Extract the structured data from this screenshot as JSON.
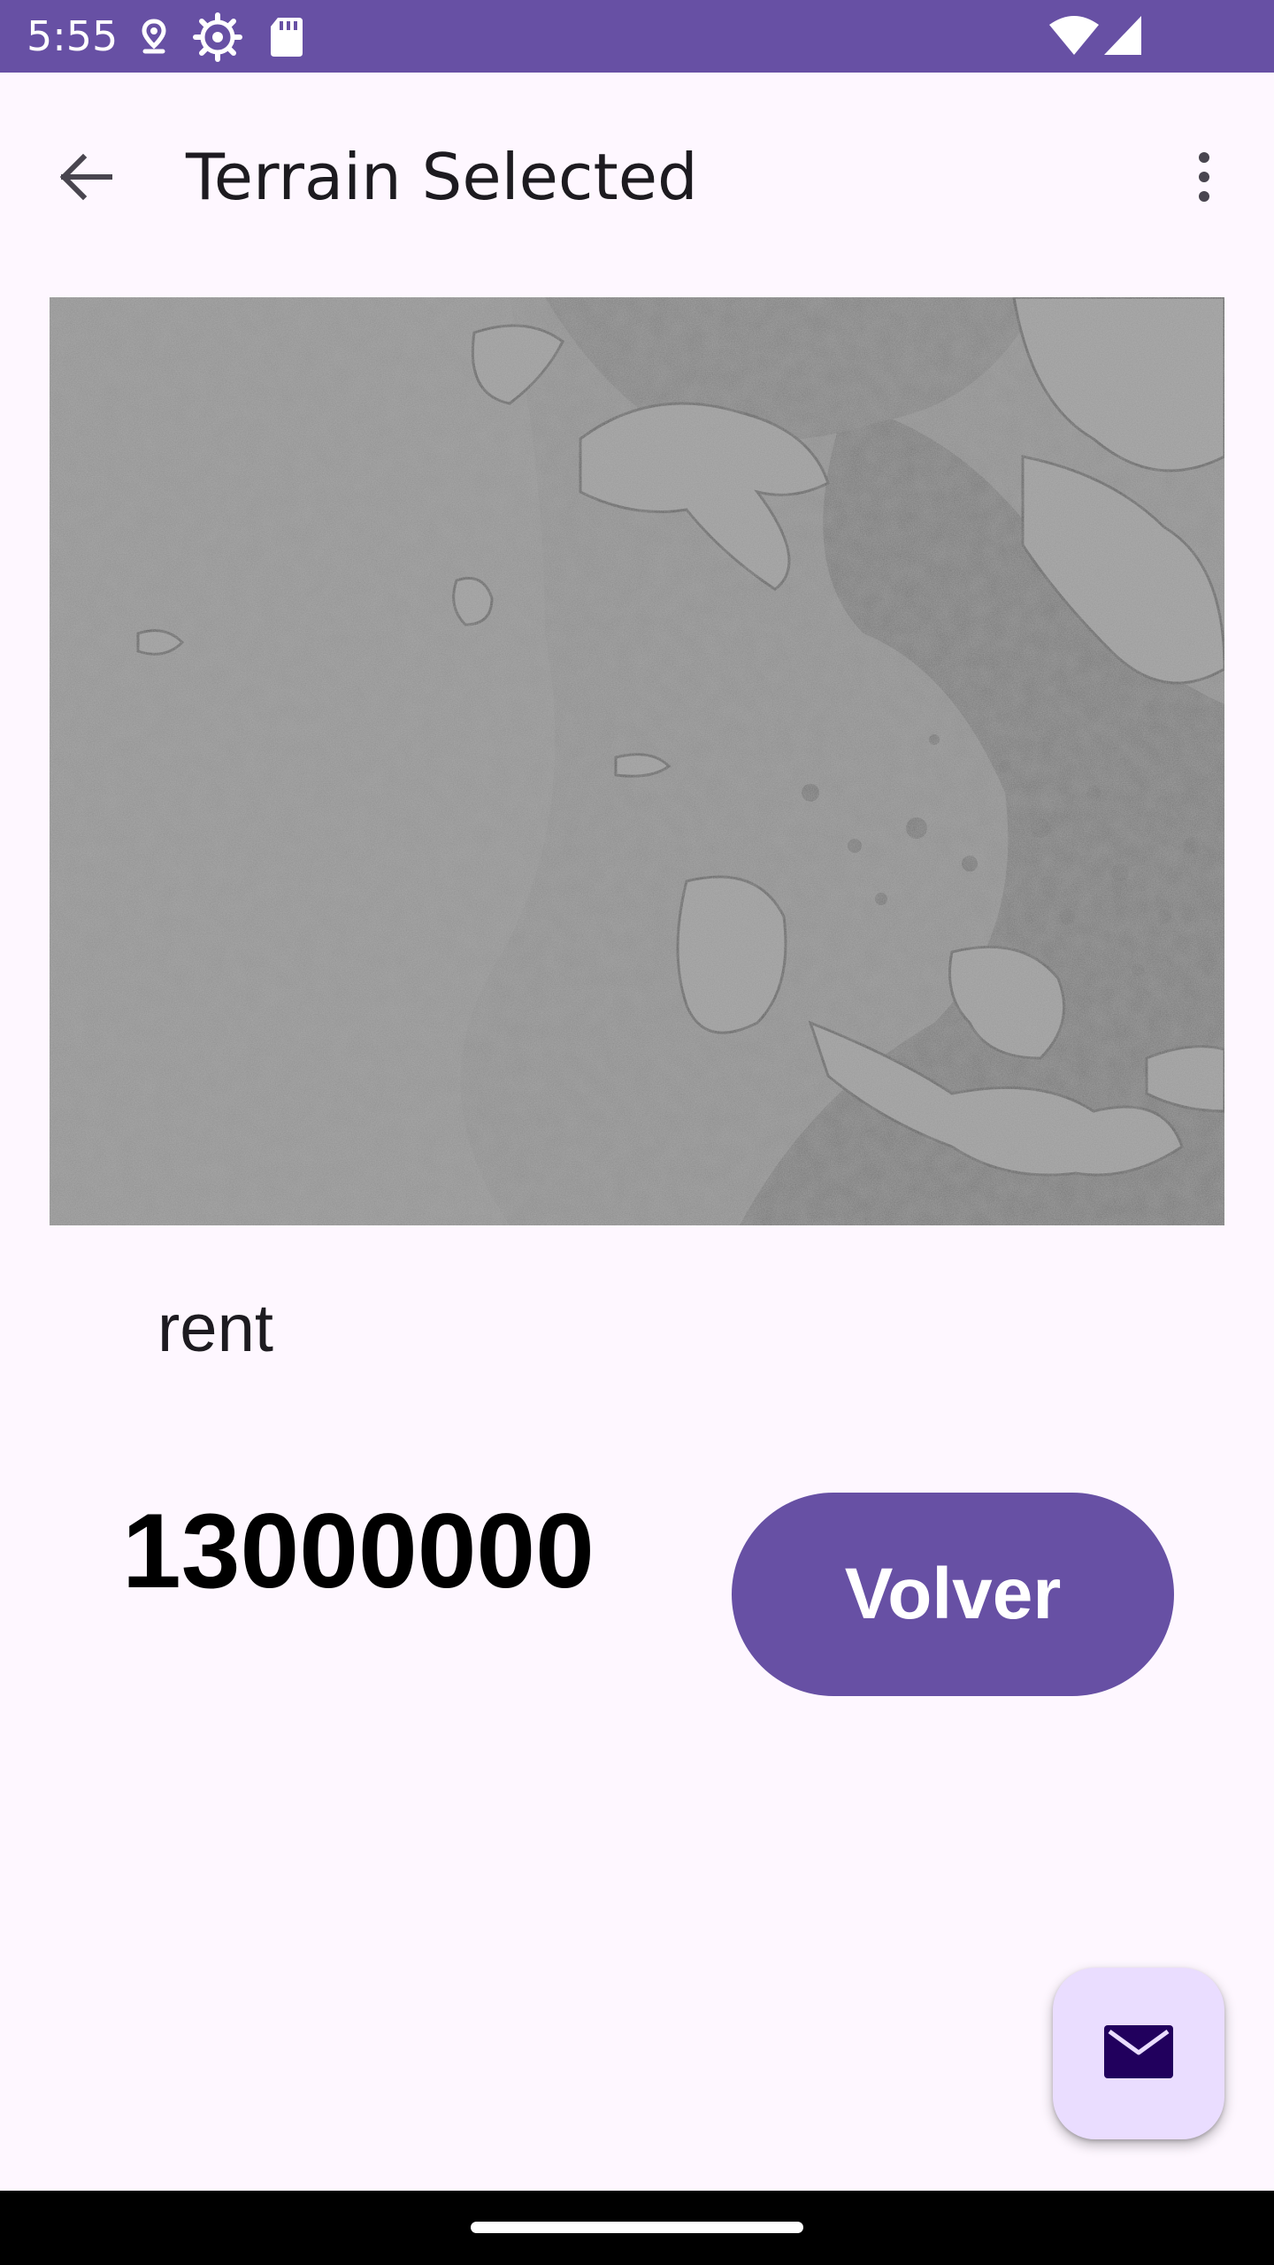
{
  "status_bar": {
    "time": "5:55",
    "icons": [
      "location-pin-icon",
      "settings-gear-icon",
      "sd-card-icon",
      "wifi-icon",
      "cellular-signal-icon"
    ],
    "background_color": "#6750A4"
  },
  "app_bar": {
    "title": "Terrain Selected",
    "back_icon": "arrow-back-icon",
    "menu_icon": "more-vert-icon"
  },
  "terrain": {
    "image_description_icon": "mars-terrain-photo",
    "type": "rent",
    "price": "13000000"
  },
  "actions": {
    "back_label": "Volver",
    "fab_icon": "mail-icon"
  },
  "colors": {
    "primary": "#6750A4",
    "background": "#FEF7FF",
    "fab_container": "#EADDFF",
    "fab_icon": "#21005D"
  }
}
